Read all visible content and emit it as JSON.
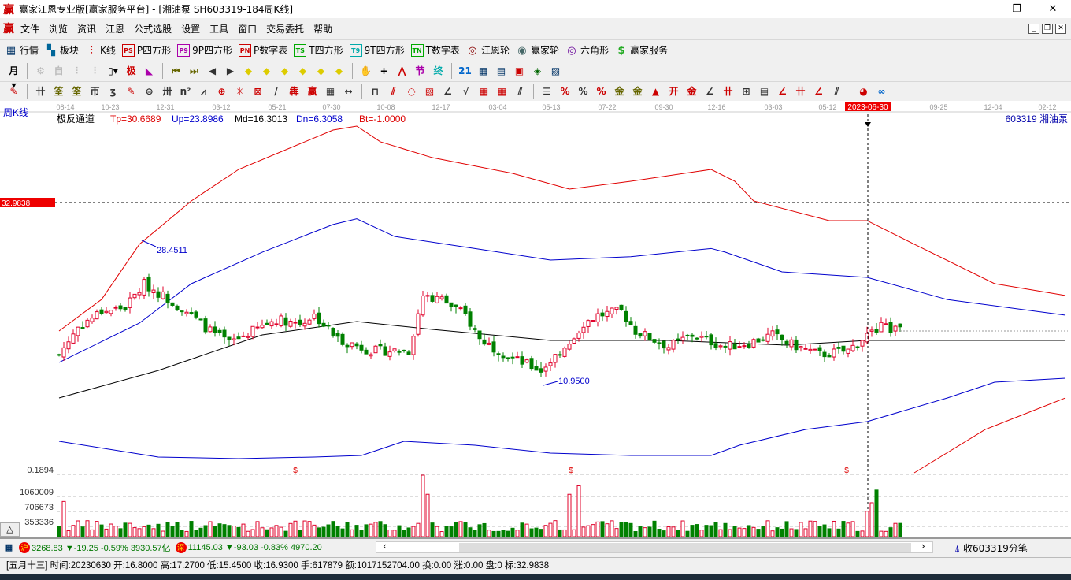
{
  "app": {
    "title": "赢家江恩专业版[赢家服务平台] - [湘油泵  SH603319-184周K线]",
    "logo": "赢",
    "min": "—",
    "max": "❐",
    "close": "✕"
  },
  "menu": [
    "文件",
    "浏览",
    "资讯",
    "江恩",
    "公式选股",
    "设置",
    "工具",
    "窗口",
    "交易委托",
    "帮助"
  ],
  "toolbar1": [
    {
      "icon": "grid-icon",
      "glyph": "▦",
      "color": "#036",
      "label": "行情"
    },
    {
      "icon": "blocks-icon",
      "glyph": "▚",
      "color": "#069",
      "label": "板块"
    },
    {
      "icon": "kline-icon",
      "glyph": "⫶",
      "color": "#c00",
      "label": "K线"
    },
    {
      "icon": "ps-icon",
      "glyph": "PS",
      "color": "#c00",
      "label": "P四方形"
    },
    {
      "icon": "p9-icon",
      "glyph": "P9",
      "color": "#a0a",
      "label": "9P四方形"
    },
    {
      "icon": "pn-icon",
      "glyph": "PN",
      "color": "#c00",
      "label": "P数字表"
    },
    {
      "icon": "ts-icon",
      "glyph": "TS",
      "color": "#0a0",
      "label": "T四方形"
    },
    {
      "icon": "t9-icon",
      "glyph": "T9",
      "color": "#0aa",
      "label": "9T四方形"
    },
    {
      "icon": "tn-icon",
      "glyph": "TN",
      "color": "#0a0",
      "label": "T数字表"
    },
    {
      "icon": "gann-wheel-icon",
      "glyph": "◎",
      "color": "#800",
      "label": "江恩轮"
    },
    {
      "icon": "win-wheel-icon",
      "glyph": "◉",
      "color": "#466",
      "label": "赢家轮"
    },
    {
      "icon": "hexagon-icon",
      "glyph": "◎",
      "color": "#609",
      "label": "六角形"
    },
    {
      "icon": "dollar-icon",
      "glyph": "$",
      "color": "#2a2",
      "label": "赢家服务"
    }
  ],
  "toolbar2": [
    {
      "n": "period-icon",
      "g": "月▾",
      "c": "#000"
    },
    {
      "n": "sep"
    },
    {
      "n": "disabled-icon",
      "g": "⚙",
      "c": "#bbb"
    },
    {
      "n": "disabled-icon",
      "g": "自",
      "c": "#bbb"
    },
    {
      "n": "disabled-icon",
      "g": "⫶",
      "c": "#bbb"
    },
    {
      "n": "disabled-icon",
      "g": "⫶",
      "c": "#bbb"
    },
    {
      "n": "candle-type-icon",
      "g": "▯▾",
      "c": "#000"
    },
    {
      "n": "formula-icon",
      "g": "极",
      "c": "#c00"
    },
    {
      "n": "chart-color-icon",
      "g": "◣",
      "c": "#a0a"
    },
    {
      "n": "sep"
    },
    {
      "n": "first-icon",
      "g": "⏮",
      "c": "#660"
    },
    {
      "n": "last-icon",
      "g": "⏭",
      "c": "#660"
    },
    {
      "n": "left-icon",
      "g": "◀",
      "c": "#333"
    },
    {
      "n": "right-icon",
      "g": "▶",
      "c": "#333"
    },
    {
      "n": "arrow-left-icon",
      "g": "◆",
      "c": "#dc0"
    },
    {
      "n": "arrow-right-icon",
      "g": "◆",
      "c": "#dc0"
    },
    {
      "n": "expand-icon",
      "g": "◆",
      "c": "#dc0"
    },
    {
      "n": "shrink-icon",
      "g": "◆",
      "c": "#dc0"
    },
    {
      "n": "up-down-icon",
      "g": "◆",
      "c": "#dc0"
    },
    {
      "n": "zoom-icon",
      "g": "◆",
      "c": "#dc0"
    },
    {
      "n": "sep"
    },
    {
      "n": "hand-icon",
      "g": "✋",
      "c": "#333"
    },
    {
      "n": "crosshair-icon",
      "g": "+",
      "c": "#000"
    },
    {
      "n": "line-icon",
      "g": "⋀",
      "c": "#c00"
    },
    {
      "n": "tool-icon",
      "g": "节",
      "c": "#a0a"
    },
    {
      "n": "tool2-icon",
      "g": "终",
      "c": "#0aa"
    },
    {
      "n": "sep"
    },
    {
      "n": "calendar-icon",
      "g": "21",
      "c": "#06c"
    },
    {
      "n": "calculator-icon",
      "g": "▦",
      "c": "#036"
    },
    {
      "n": "notes-icon",
      "g": "▤",
      "c": "#036"
    },
    {
      "n": "save-icon",
      "g": "▣",
      "c": "#c00"
    },
    {
      "n": "network-icon",
      "g": "◈",
      "c": "#060"
    },
    {
      "n": "print-icon",
      "g": "▨",
      "c": "#036"
    }
  ],
  "toolbar3": [
    {
      "n": "pen-icon",
      "g": "✎",
      "c": "#c00"
    },
    {
      "n": "sep"
    },
    {
      "n": "tool-icon",
      "g": "卄",
      "c": "#333"
    },
    {
      "n": "tool-icon",
      "g": "筌",
      "c": "#660"
    },
    {
      "n": "tool-icon",
      "g": "筌",
      "c": "#660"
    },
    {
      "n": "tool-icon",
      "g": "帀",
      "c": "#333"
    },
    {
      "n": "tool-icon",
      "g": "ʒ",
      "c": "#333"
    },
    {
      "n": "tool-icon",
      "g": "✎",
      "c": "#c00"
    },
    {
      "n": "tool-icon",
      "g": "⊜",
      "c": "#333"
    },
    {
      "n": "tool-icon",
      "g": "卅",
      "c": "#333"
    },
    {
      "n": "tool-icon",
      "g": "n²",
      "c": "#333"
    },
    {
      "n": "tool-icon",
      "g": "⩘",
      "c": "#333"
    },
    {
      "n": "tool-icon",
      "g": "⊕",
      "c": "#c00"
    },
    {
      "n": "tool-icon",
      "g": "✳",
      "c": "#c00"
    },
    {
      "n": "tool-icon",
      "g": "⊠",
      "c": "#c00"
    },
    {
      "n": "tool-icon",
      "g": "/",
      "c": "#333"
    },
    {
      "n": "tool-icon",
      "g": "犇",
      "c": "#c00"
    },
    {
      "n": "tool-icon",
      "g": "赢",
      "c": "#c00"
    },
    {
      "n": "tool-icon",
      "g": "▦",
      "c": "#333"
    },
    {
      "n": "tool-icon",
      "g": "↔",
      "c": "#333"
    },
    {
      "n": "sep"
    },
    {
      "n": "tool-icon",
      "g": "⊓",
      "c": "#333"
    },
    {
      "n": "tool-icon",
      "g": "⫽",
      "c": "#c00"
    },
    {
      "n": "tool-icon",
      "g": "◌",
      "c": "#c00"
    },
    {
      "n": "tool-icon",
      "g": "▧",
      "c": "#c00"
    },
    {
      "n": "tool-icon",
      "g": "∠",
      "c": "#333"
    },
    {
      "n": "tool-icon",
      "g": "√",
      "c": "#333"
    },
    {
      "n": "tool-icon",
      "g": "▦",
      "c": "#c00"
    },
    {
      "n": "tool-icon",
      "g": "▦",
      "c": "#c00"
    },
    {
      "n": "tool-icon",
      "g": "⫽",
      "c": "#333"
    },
    {
      "n": "sep"
    },
    {
      "n": "tool-icon",
      "g": "☰",
      "c": "#333"
    },
    {
      "n": "tool-icon",
      "g": "%",
      "c": "#c00"
    },
    {
      "n": "percent-icon",
      "g": "%",
      "c": "#333"
    },
    {
      "n": "tool-icon",
      "g": "%",
      "c": "#c00"
    },
    {
      "n": "tool-icon",
      "g": "金",
      "c": "#660"
    },
    {
      "n": "tool-icon",
      "g": "金",
      "c": "#660"
    },
    {
      "n": "tool-icon",
      "g": "▲",
      "c": "#c00"
    },
    {
      "n": "tool-icon",
      "g": "开",
      "c": "#c00"
    },
    {
      "n": "tool-icon",
      "g": "金",
      "c": "#c00"
    },
    {
      "n": "tool-icon",
      "g": "∠",
      "c": "#333"
    },
    {
      "n": "tool-icon",
      "g": "卄",
      "c": "#c00"
    },
    {
      "n": "tool-icon",
      "g": "⊞",
      "c": "#333"
    },
    {
      "n": "tool-icon",
      "g": "▤",
      "c": "#333"
    },
    {
      "n": "tool-icon",
      "g": "∠",
      "c": "#c00"
    },
    {
      "n": "tool-icon",
      "g": "卄",
      "c": "#c00"
    },
    {
      "n": "tool-icon",
      "g": "∠",
      "c": "#c00"
    },
    {
      "n": "tool-icon",
      "g": "⫽",
      "c": "#333"
    },
    {
      "n": "sep"
    },
    {
      "n": "globe-icon",
      "g": "◕",
      "c": "#c00"
    },
    {
      "n": "infinity-icon",
      "g": "∞",
      "c": "#06c"
    }
  ],
  "chart": {
    "period_label": "周K线",
    "indicator": {
      "name": "极反通道",
      "tp": "Tp=30.6689",
      "up": "Up=23.8986",
      "md": "Md=16.3013",
      "dn": "Dn=6.3058",
      "bt": "Bt=-1.0000"
    },
    "stock": "603319  湘油泵",
    "date_ticks": [
      "08-14",
      "10-23",
      "12-31",
      "03-12",
      "05-21",
      "07-30",
      "10-08",
      "12-17",
      "03-04",
      "05-13",
      "07-22",
      "09-30",
      "12-16",
      "03-03",
      "05-12",
      "2023-06-30",
      "09-25",
      "12-04",
      "02-12"
    ],
    "cursor_price": "32.9838",
    "high_label": "28.4511",
    "low_label": "10.9500",
    "vol_axis": [
      "0.1894",
      "1060009",
      "706673",
      "353336"
    ],
    "dollar_marker": "$",
    "colors": {
      "up": "#e0002a",
      "down": "#008000",
      "upper_outer": "#e00000",
      "upper_inner": "#0000cc",
      "mid": "#000000",
      "lower_inner": "#0000cc",
      "lower_outer": "#e00000"
    }
  },
  "chart_data": {
    "type": "candlestick",
    "price_scale": {
      "ref_price": 32.98,
      "units": "CNY"
    },
    "close_keyframes": [
      [
        0,
        14.6
      ],
      [
        4,
        17.97
      ],
      [
        9,
        19.88
      ],
      [
        14,
        20.36
      ],
      [
        18,
        23.2
      ],
      [
        22,
        21.79
      ],
      [
        27,
        19.88
      ],
      [
        32,
        17.49
      ],
      [
        36,
        16.06
      ],
      [
        41,
        17.49
      ],
      [
        46,
        18.93
      ],
      [
        51,
        18.45
      ],
      [
        54,
        19.4
      ],
      [
        59,
        16.54
      ],
      [
        66,
        15.1
      ],
      [
        74,
        15.1
      ],
      [
        77,
        21.79
      ],
      [
        81,
        21.32
      ],
      [
        86,
        19.4
      ],
      [
        89,
        16.54
      ],
      [
        96,
        14.15
      ],
      [
        102,
        12.71
      ],
      [
        107,
        15.58
      ],
      [
        111,
        18.45
      ],
      [
        114,
        19.4
      ],
      [
        119,
        19.88
      ],
      [
        122,
        17.49
      ],
      [
        129,
        15.58
      ],
      [
        134,
        17.01
      ],
      [
        141,
        15.58
      ],
      [
        146,
        16.06
      ],
      [
        151,
        17.01
      ],
      [
        154,
        16.06
      ],
      [
        161,
        14.62
      ],
      [
        167,
        15.1
      ],
      [
        171,
        17.01
      ],
      [
        174,
        17.97
      ],
      [
        178,
        17.49
      ]
    ],
    "bands": {
      "upper_outer": [
        [
          0,
          17.49
        ],
        [
          9,
          21.32
        ],
        [
          17,
          28.01
        ],
        [
          28,
          33.27
        ],
        [
          38,
          37.09
        ],
        [
          58,
          41.87
        ],
        [
          63,
          42.35
        ],
        [
          68,
          40.44
        ],
        [
          79,
          38.52
        ],
        [
          96,
          36.61
        ],
        [
          108,
          34.7
        ],
        [
          121,
          35.66
        ],
        [
          138,
          37.09
        ],
        [
          143,
          35.66
        ],
        [
          147,
          33.27
        ],
        [
          163,
          30.88
        ],
        [
          171,
          30.88
        ],
        [
          181,
          28.01
        ],
        [
          198,
          23.23
        ],
        [
          213,
          21.79
        ]
      ],
      "upper_inner": [
        [
          0,
          13.67
        ],
        [
          17,
          18.45
        ],
        [
          28,
          23.23
        ],
        [
          43,
          27.05
        ],
        [
          58,
          30.41
        ],
        [
          63,
          31.1
        ],
        [
          71,
          28.96
        ],
        [
          88,
          27.5
        ],
        [
          104,
          26.1
        ],
        [
          121,
          26.5
        ],
        [
          138,
          27.5
        ],
        [
          141,
          27.05
        ],
        [
          153,
          24.66
        ],
        [
          171,
          23.99
        ],
        [
          188,
          21.3
        ],
        [
          213,
          19.4
        ]
      ],
      "mid": [
        [
          0,
          9.37
        ],
        [
          21,
          12.7
        ],
        [
          43,
          17.01
        ],
        [
          63,
          18.64
        ],
        [
          79,
          17.68
        ],
        [
          104,
          16.35
        ],
        [
          129,
          16.35
        ],
        [
          154,
          15.77
        ],
        [
          171,
          16.35
        ],
        [
          213,
          16.35
        ]
      ],
      "lower_inner": [
        [
          0,
          4.11
        ],
        [
          21,
          2.2
        ],
        [
          38,
          2.01
        ],
        [
          54,
          2.2
        ],
        [
          64,
          2.39
        ],
        [
          73,
          4.11
        ],
        [
          88,
          3.63
        ],
        [
          104,
          2.67
        ],
        [
          121,
          2.39
        ],
        [
          138,
          2.39
        ],
        [
          144,
          3.63
        ],
        [
          158,
          5.54
        ],
        [
          171,
          6.5
        ],
        [
          188,
          9.37
        ],
        [
          198,
          11.28
        ],
        [
          213,
          11.76
        ]
      ],
      "lower_outer": [
        [
          181,
          0.28
        ],
        [
          196,
          5.54
        ],
        [
          213,
          9.37
        ]
      ]
    },
    "volume_spikes": [
      [
        1,
        830000
      ],
      [
        77,
        1450000
      ],
      [
        78,
        1000000
      ],
      [
        108,
        1000000
      ],
      [
        110,
        1200000
      ],
      [
        171,
        600000
      ],
      [
        172,
        800000
      ],
      [
        173,
        1100000
      ]
    ],
    "volume_axis": [
      353336,
      706673,
      1060009
    ]
  },
  "ticker": {
    "sh_badge": "沪",
    "sh": "3268.83 ▼-19.25 -0.59% 3930.57亿",
    "sz_badge": "深",
    "sz": "11145.03 ▼-93.03 -0.83% 4970.20",
    "prev": "‹",
    "next": "›",
    "tick_label": "收603319分笔"
  },
  "status": "[五月十三] 时间:20230630 开:16.8000 高:17.2700 低:15.4500 收:16.9300 手:617879 额:1017152704.00 换:0.00 涨:0.00 盘:0 标:32.9838",
  "triangle_button": "△"
}
